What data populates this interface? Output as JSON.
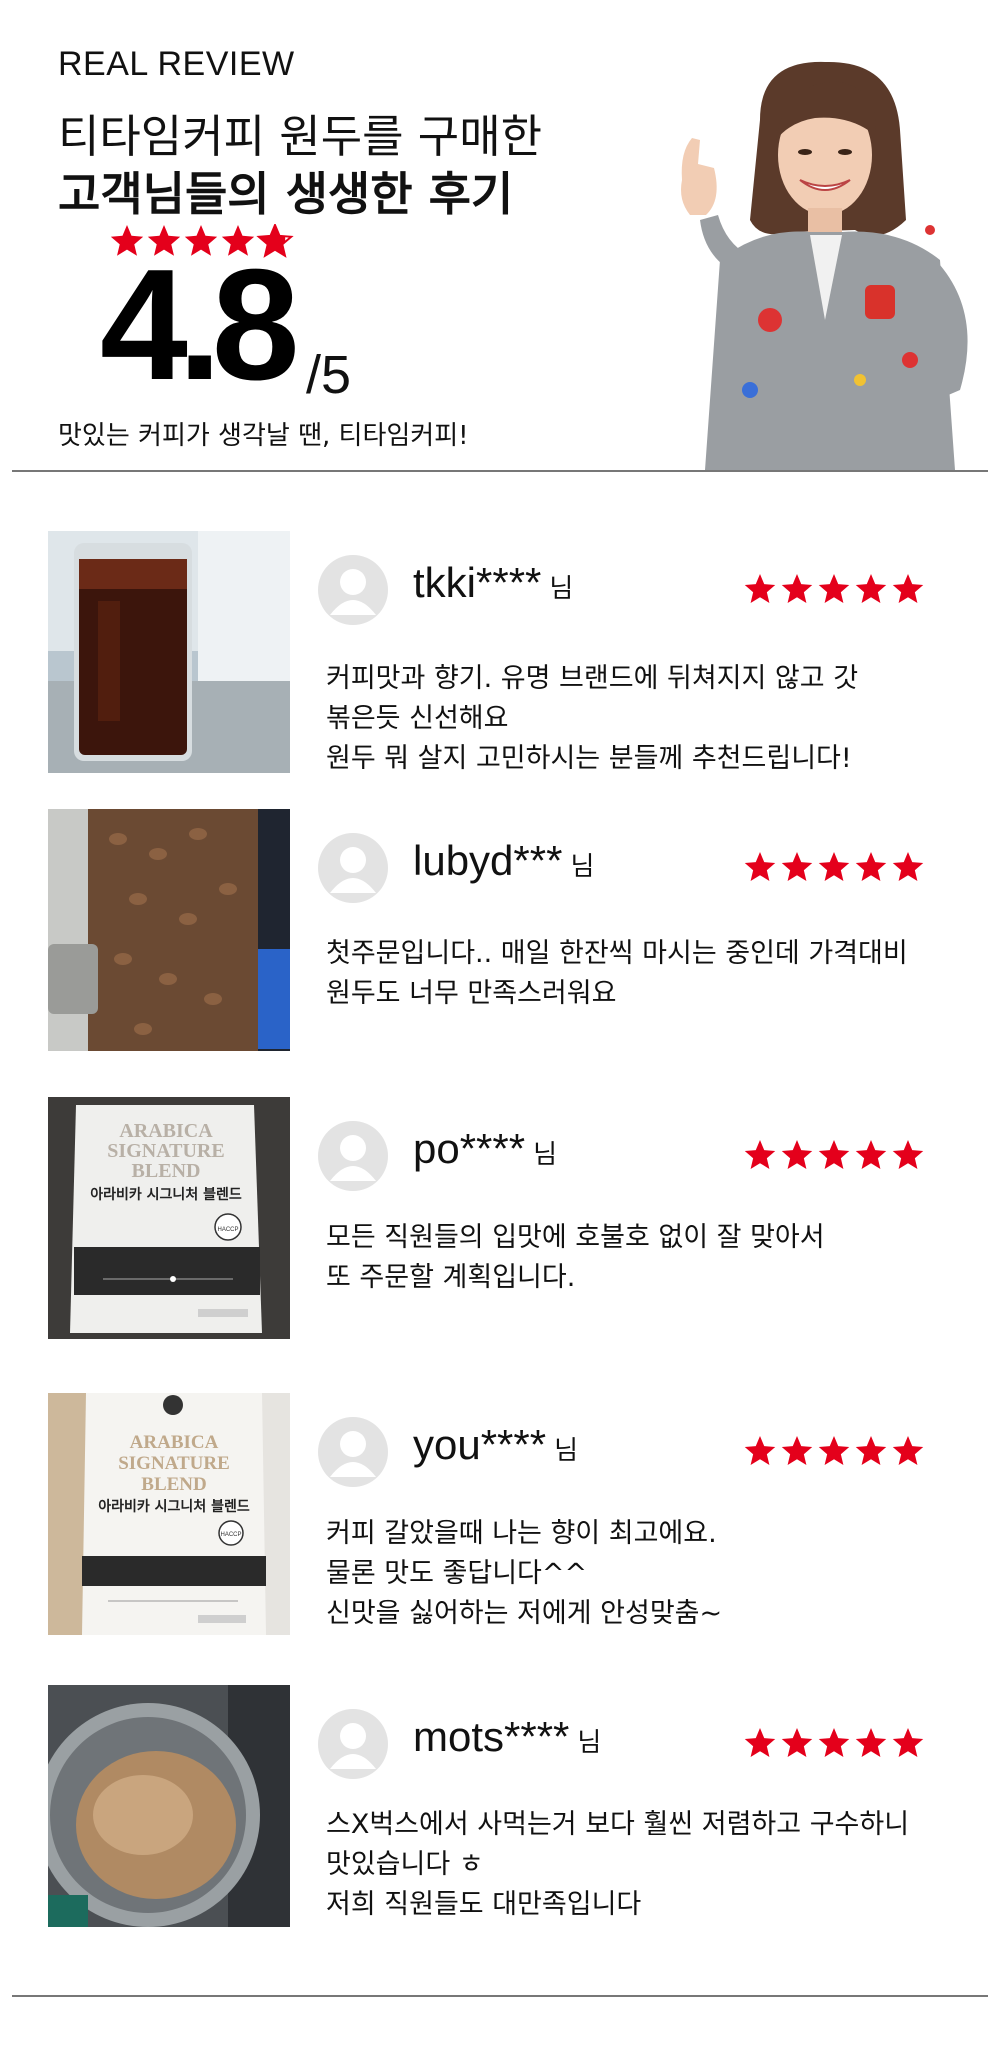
{
  "header": {
    "label": "REAL REVIEW",
    "headline_line1": "티타임커피 원두를 구매한",
    "headline_line2": "고객님들의 생생한 후기",
    "rating_value": "4.8",
    "rating_max": "/5",
    "rating_stars": 4.8,
    "tagline": "맛있는 커피가 생각날 땐, 티타임커피!"
  },
  "colors": {
    "star_red": "#e4001b",
    "divider": "#777777",
    "avatar_gray": "#e3e3e3"
  },
  "honorific": "님",
  "reviews": [
    {
      "username": "tkki****",
      "honorific": "님",
      "stars": 5,
      "photo": "iced-coffee-glass",
      "lines": [
        "커피맛과 향기. 유명 브랜드에 뒤쳐지지 않고 갓",
        "볶은듯 신선해요",
        "원두 뭐 살지 고민하시는 분들께 추천드립니다!"
      ]
    },
    {
      "username": "lubyd***",
      "honorific": "님",
      "stars": 5,
      "photo": "coffee-beans-container",
      "lines": [
        "첫주문입니다.. 매일 한잔씩 마시는 중인데 가격대비",
        "원두도 너무 만족스러워요"
      ]
    },
    {
      "username": "po****",
      "honorific": "님",
      "stars": 5,
      "photo": "coffee-bag-dark",
      "bag_text": {
        "title1": "ARABICA",
        "title2": "SIGNATURE",
        "title3": "BLEND",
        "korean": "아라비카 시그니처 블렌드",
        "badge": "HACCP"
      },
      "lines": [
        "모든 직원들의 입맛에 호불호 없이 잘 맞아서",
        "또 주문할 계획입니다."
      ]
    },
    {
      "username": "you****",
      "honorific": "님",
      "stars": 5,
      "photo": "coffee-bag-light",
      "bag_text": {
        "title1": "ARABICA",
        "title2": "SIGNATURE",
        "title3": "BLEND",
        "korean": "아라비카 시그니처 블렌드",
        "badge": "HACCP"
      },
      "lines": [
        "커피 갈았을때 나는 향이 최고에요.",
        "물론 맛도 좋답니다^^",
        "신맛을 싫어하는 저에게 안성맞춤~"
      ]
    },
    {
      "username": "mots****",
      "honorific": "님",
      "stars": 5,
      "photo": "coffee-tumbler",
      "lines": [
        "스X벅스에서 사먹는거 보다 훨씬 저렴하고 구수하니",
        "맛있습니다 ㅎ",
        "저희 직원들도 대만족입니다"
      ]
    }
  ]
}
